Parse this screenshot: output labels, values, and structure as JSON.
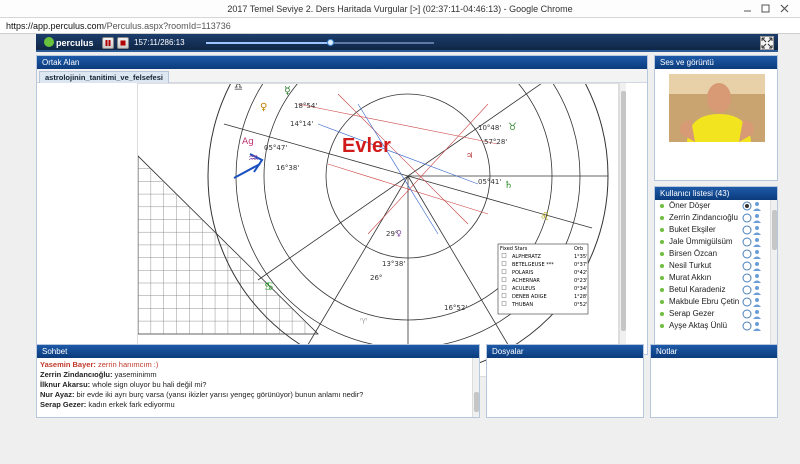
{
  "window": {
    "title": "2017 Temel Seviye 2. Ders Haritada Vurgular [>] (02:37:11-04:46:13) - Google Chrome"
  },
  "address": {
    "domain": "https://app.perculus.com",
    "path": "/Perculus.aspx?roomId=113736"
  },
  "toolbar": {
    "brand": "perculus",
    "time": "157:11/286:13",
    "progress": 0.55
  },
  "colors": {
    "header": "#0b3b7c",
    "toolbar": "#1c3d6b",
    "online": "#6fbf3a",
    "chat_highlight": "#c0392b",
    "chart_title": "#d11b1b"
  },
  "shared_area": {
    "title": "Ortak Alan",
    "tab": "astrolojinin_tanitimi_ve_felsefesi",
    "chart_title": "Evler",
    "chart_labels": [
      "18°54'",
      "14°14'",
      "05°47'",
      "16°38'",
      "10°48'",
      "57°28'",
      "05°41'",
      "29°",
      "26°",
      "13°38'",
      "16°52'"
    ],
    "fixed_stars": {
      "title": "Fixed Stars",
      "orb_label": "Orb",
      "rows": [
        {
          "name": "ALPHERATZ",
          "orb": "1°35'"
        },
        {
          "name": "BETELGEUSE ***",
          "orb": "0°37'"
        },
        {
          "name": "POLARIS",
          "orb": "0°42'"
        },
        {
          "name": "ACHERNAR",
          "orb": "0°23'"
        },
        {
          "name": "ACULEUS",
          "orb": "0°34'"
        },
        {
          "name": "DENEB ADIGE",
          "orb": "1°28'"
        },
        {
          "name": "THUBAN",
          "orb": "0°52'"
        }
      ]
    }
  },
  "video": {
    "title": "Ses ve görüntü"
  },
  "users": {
    "title": "Kullanıcı listesi (43)",
    "list": [
      "Öner Döşer",
      "Zerrin Zindancıoğlu",
      "Buket Ekşiler",
      "Jale Ümmigülsüm",
      "Birsen Özcan",
      "Nesil Turkut",
      "Murat Akkın",
      "Betul Karadeniz",
      "Makbule Ebru Çetin",
      "Serap Gezer",
      "Ayşe Aktaş Ünlü"
    ]
  },
  "chat": {
    "title": "Sohbet",
    "messages": [
      {
        "name": "Yasemin  Bayer:",
        "text": " zerrin hanımcım :)"
      },
      {
        "name": "Zerrin Zindancıoğlu:",
        "text": " yaseminimm"
      },
      {
        "name": "İlknur Akarsu:",
        "text": " whole sign oluyor bu hali değil mi?"
      },
      {
        "name": "Nur Ayaz:",
        "text": " bir evde iki ayrı burç varsa (yansı ikizler yarısı yengeç görünüyor) bunun anlamı nedir?"
      },
      {
        "name": "Serap Gezer:",
        "text": " kadın erkek fark ediyormu"
      }
    ]
  },
  "files": {
    "title": "Dosyalar"
  },
  "notes": {
    "title": "Notlar"
  }
}
